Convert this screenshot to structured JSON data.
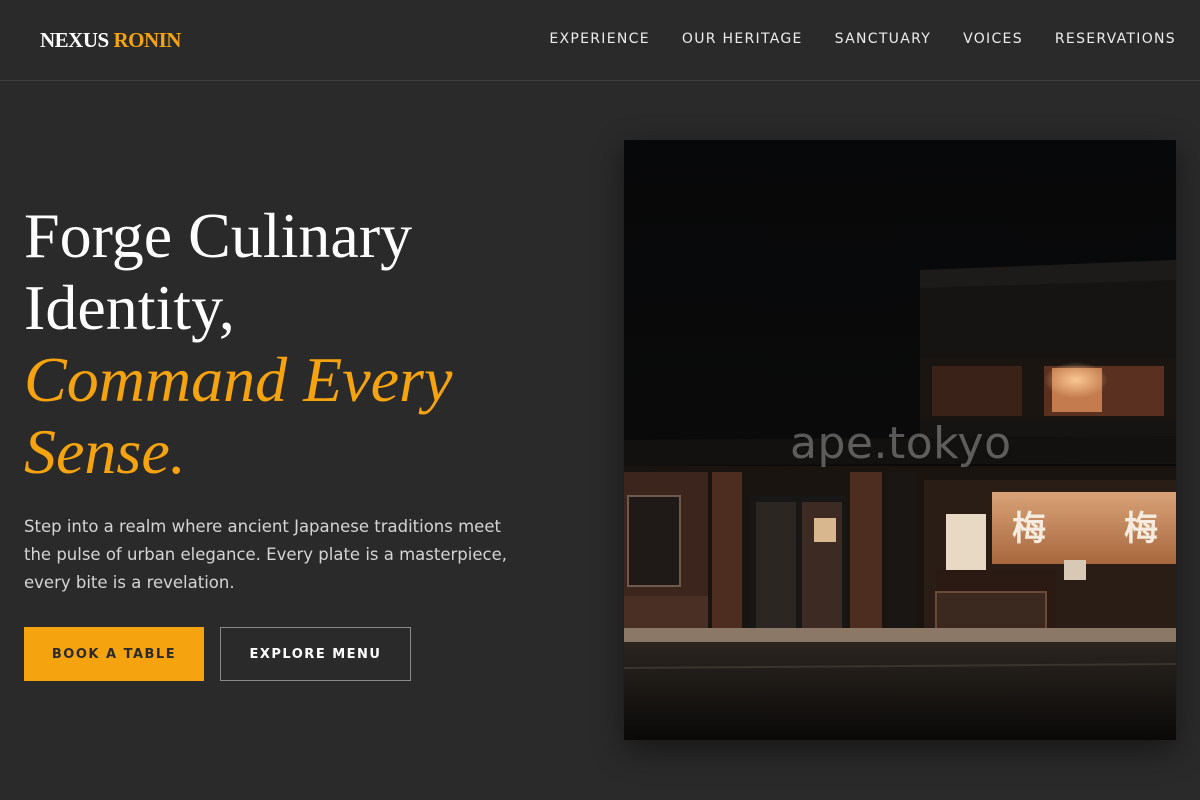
{
  "brand": {
    "word1": "NEXUS",
    "word2": "RONIN"
  },
  "nav": {
    "items": [
      {
        "label": "EXPERIENCE"
      },
      {
        "label": "OUR HERITAGE"
      },
      {
        "label": "SANCTUARY"
      },
      {
        "label": "VOICES"
      },
      {
        "label": "RESERVATIONS"
      }
    ]
  },
  "hero": {
    "title_line1": "Forge Culinary",
    "title_line2": "Identity,",
    "accent_line1": "Command Every",
    "accent_line2": "Sense.",
    "body": "Step into a realm where ancient Japanese traditions meet the pulse of urban elegance. Every plate is a masterpiece, every bite is a revelation.",
    "primary_cta": "BOOK A TABLE",
    "secondary_cta": "EXPLORE MENU"
  },
  "photo": {
    "watermark": "ape.tokyo"
  },
  "colors": {
    "accent": "#f5a30f",
    "background": "#2a2a2a",
    "text": "#ffffff"
  }
}
